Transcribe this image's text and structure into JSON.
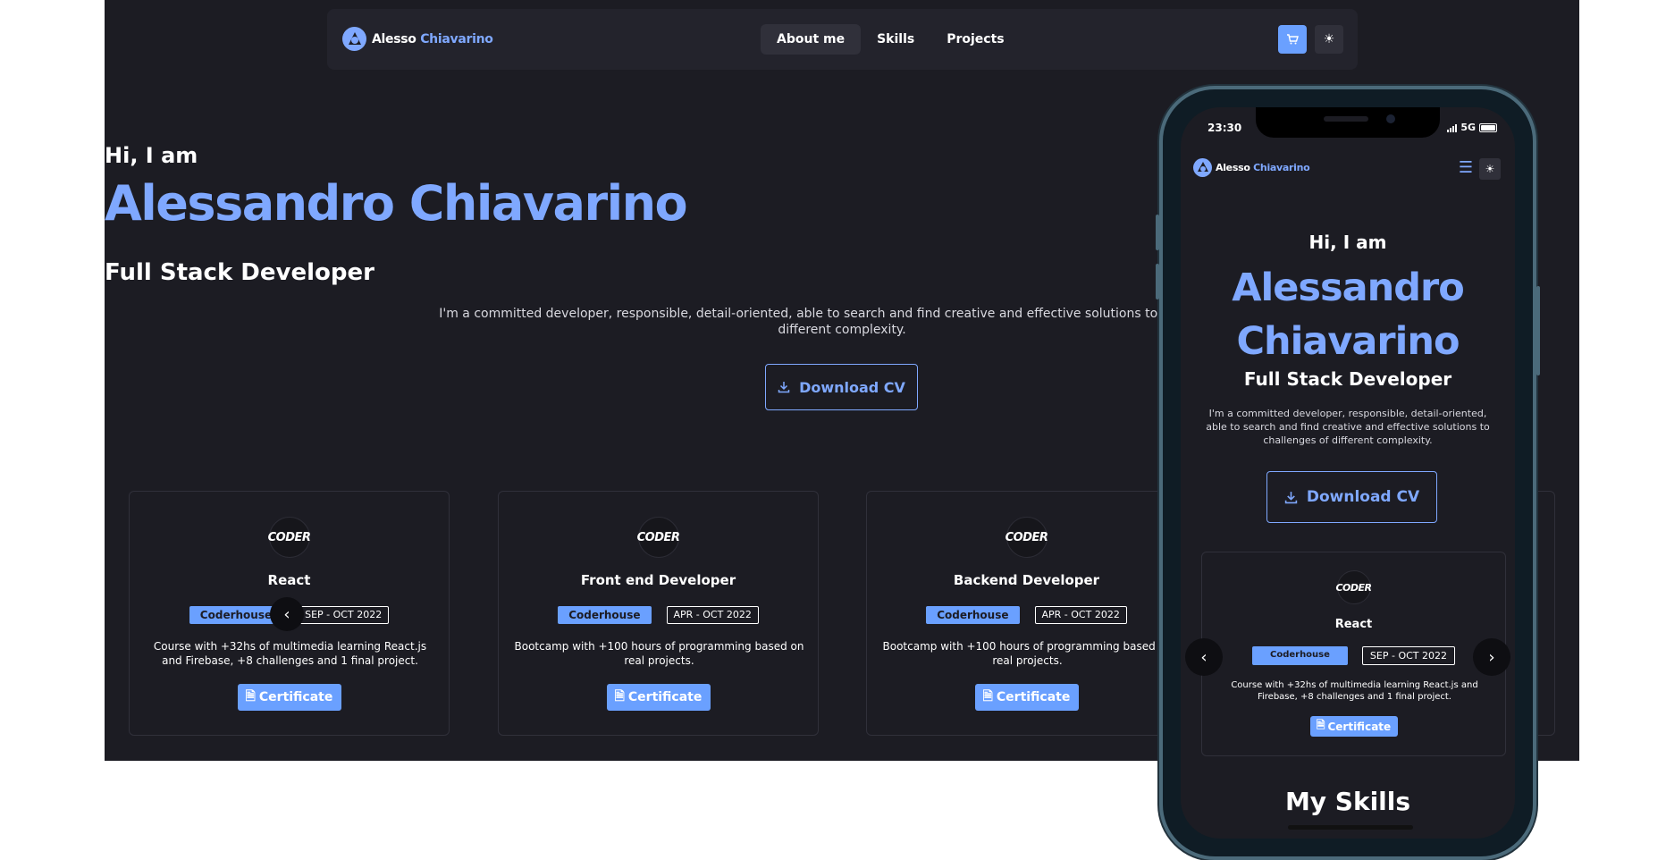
{
  "desktop": {
    "logo": {
      "first": "Alesso",
      "second": "Chiavarino"
    },
    "nav": {
      "about": "About me",
      "skills": "Skills",
      "projects": "Projects"
    },
    "hero": {
      "greeting": "Hi, I am",
      "name": "Alessandro Chiavarino",
      "role": "Full Stack Developer",
      "description": "I'm a committed developer, responsible, detail-oriented, able to search and find creative and effective solutions to challenges of different complexity.",
      "cv_button": "Download CV"
    },
    "cards": [
      {
        "logo": "CODER",
        "title": "React",
        "school": "Coderhouse",
        "date": "SEP - OCT 2022",
        "description": "Course with +32hs of multimedia learning React.js and Firebase, +8 challenges and 1 final project.",
        "button": "Certificate"
      },
      {
        "logo": "CODER",
        "title": "Front end Developer",
        "school": "Coderhouse",
        "date": "APR - OCT 2022",
        "description": "Bootcamp with +100 hours of programming based on real projects.",
        "button": "Certificate"
      },
      {
        "logo": "CODER",
        "title": "Backend Developer",
        "school": "Coderhouse",
        "date": "APR - OCT 2022",
        "description": "Bootcamp with +100 hours of programming based on real projects.",
        "button": "Certificate"
      }
    ]
  },
  "mobile": {
    "status": {
      "time": "23:30",
      "network": "5G"
    },
    "logo": {
      "first": "Alesso",
      "second": "Chiavarino"
    },
    "hero": {
      "greeting": "Hi, I am",
      "name_line1": "Alessandro",
      "name_line2": "Chiavarino",
      "role": "Full Stack Developer",
      "description": "I'm a committed developer, responsible, detail-oriented, able to search and find creative and effective solutions to challenges of different complexity.",
      "cv_button": "Download CV"
    },
    "card": {
      "logo": "CODER",
      "title": "React",
      "school": "Coderhouse",
      "date": "SEP - OCT 2022",
      "description": "Course with +32hs of multimedia learning React.js and Firebase, +8 challenges and 1 final project.",
      "button": "Certificate"
    },
    "next_section": "My Skills"
  },
  "colors": {
    "background": "#1c1c23",
    "accent": "#7fa8ff",
    "button": "#6aa0ff",
    "card_border": "#30303a"
  },
  "icons": [
    "logo-icon",
    "cart-icon",
    "sun-icon",
    "download-icon",
    "certificate-icon",
    "chevron-left-icon",
    "chevron-right-icon",
    "hamburger-menu-icon"
  ]
}
